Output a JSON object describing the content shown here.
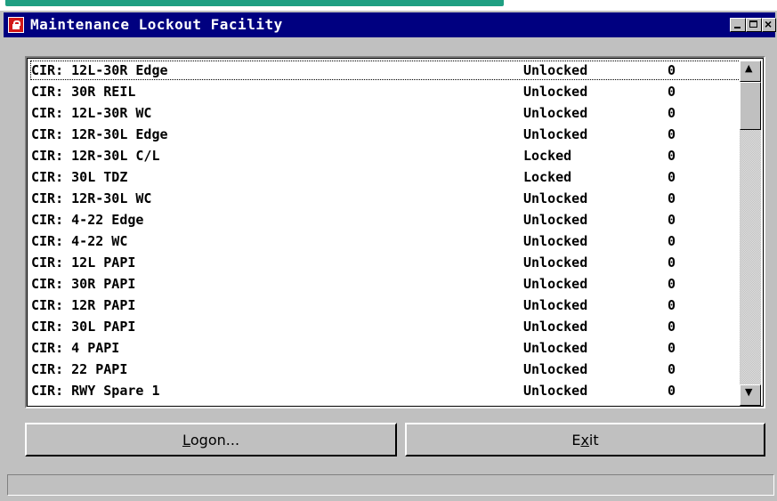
{
  "window": {
    "title": "Maintenance Lockout Facility",
    "close_glyph": "×"
  },
  "list": {
    "items": [
      {
        "name": "CIR: 12L-30R Edge",
        "status": "Unlocked",
        "count": "0"
      },
      {
        "name": "CIR: 30R REIL",
        "status": "Unlocked",
        "count": "0"
      },
      {
        "name": "CIR: 12L-30R WC",
        "status": "Unlocked",
        "count": "0"
      },
      {
        "name": "CIR: 12R-30L Edge",
        "status": "Unlocked",
        "count": "0"
      },
      {
        "name": "CIR: 12R-30L C/L",
        "status": "Locked",
        "count": "0"
      },
      {
        "name": "CIR: 30L TDZ",
        "status": "Locked",
        "count": "0"
      },
      {
        "name": "CIR: 12R-30L WC",
        "status": "Unlocked",
        "count": "0"
      },
      {
        "name": "CIR: 4-22 Edge",
        "status": "Unlocked",
        "count": "0"
      },
      {
        "name": "CIR: 4-22 WC",
        "status": "Unlocked",
        "count": "0"
      },
      {
        "name": "CIR: 12L PAPI",
        "status": "Unlocked",
        "count": "0"
      },
      {
        "name": "CIR: 30R PAPI",
        "status": "Unlocked",
        "count": "0"
      },
      {
        "name": "CIR: 12R PAPI",
        "status": "Unlocked",
        "count": "0"
      },
      {
        "name": "CIR: 30L PAPI",
        "status": "Unlocked",
        "count": "0"
      },
      {
        "name": "CIR: 4 PAPI",
        "status": "Unlocked",
        "count": "0"
      },
      {
        "name": "CIR: 22 PAPI",
        "status": "Unlocked",
        "count": "0"
      },
      {
        "name": "CIR: RWY Spare 1",
        "status": "Unlocked",
        "count": "0"
      }
    ]
  },
  "scrollbar": {
    "up_glyph": "▲",
    "down_glyph": "▼",
    "position_fraction": 0.0
  },
  "buttons": {
    "logon_mnemonic": "L",
    "logon_rest": "ogon...",
    "exit_before": "E",
    "exit_mnemonic": "x",
    "exit_after": "it"
  },
  "statusbar": {
    "text": ""
  },
  "colors": {
    "titlebar": "#000080",
    "face": "#c0c0c0",
    "app_icon": "#d21919"
  }
}
